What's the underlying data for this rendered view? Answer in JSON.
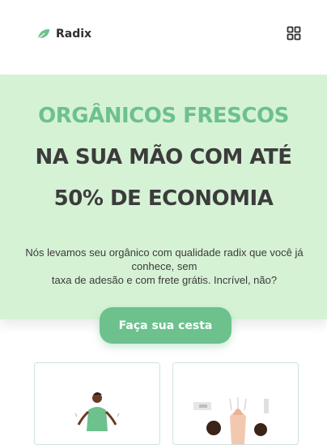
{
  "brand": {
    "name": "Radix",
    "icon": "leaf-icon"
  },
  "header": {
    "menu_icon": "grid-icon"
  },
  "hero": {
    "line1": "ORGÂNICOS FRESCOS",
    "line2": "NA SUA MÃO COM ATÉ",
    "line3": "50% DE ECONOMIA",
    "desc1": "Nós levamos seu orgânico com qualidade radix que você já conhece, sem",
    "desc2": "taxa de adesão e com frete grátis. Incrível, não?"
  },
  "cta": {
    "label": "Faça sua cesta"
  },
  "colors": {
    "accent": "#6cc18c",
    "hero_bg": "#d6f2d5",
    "text": "#3c3c3c"
  }
}
